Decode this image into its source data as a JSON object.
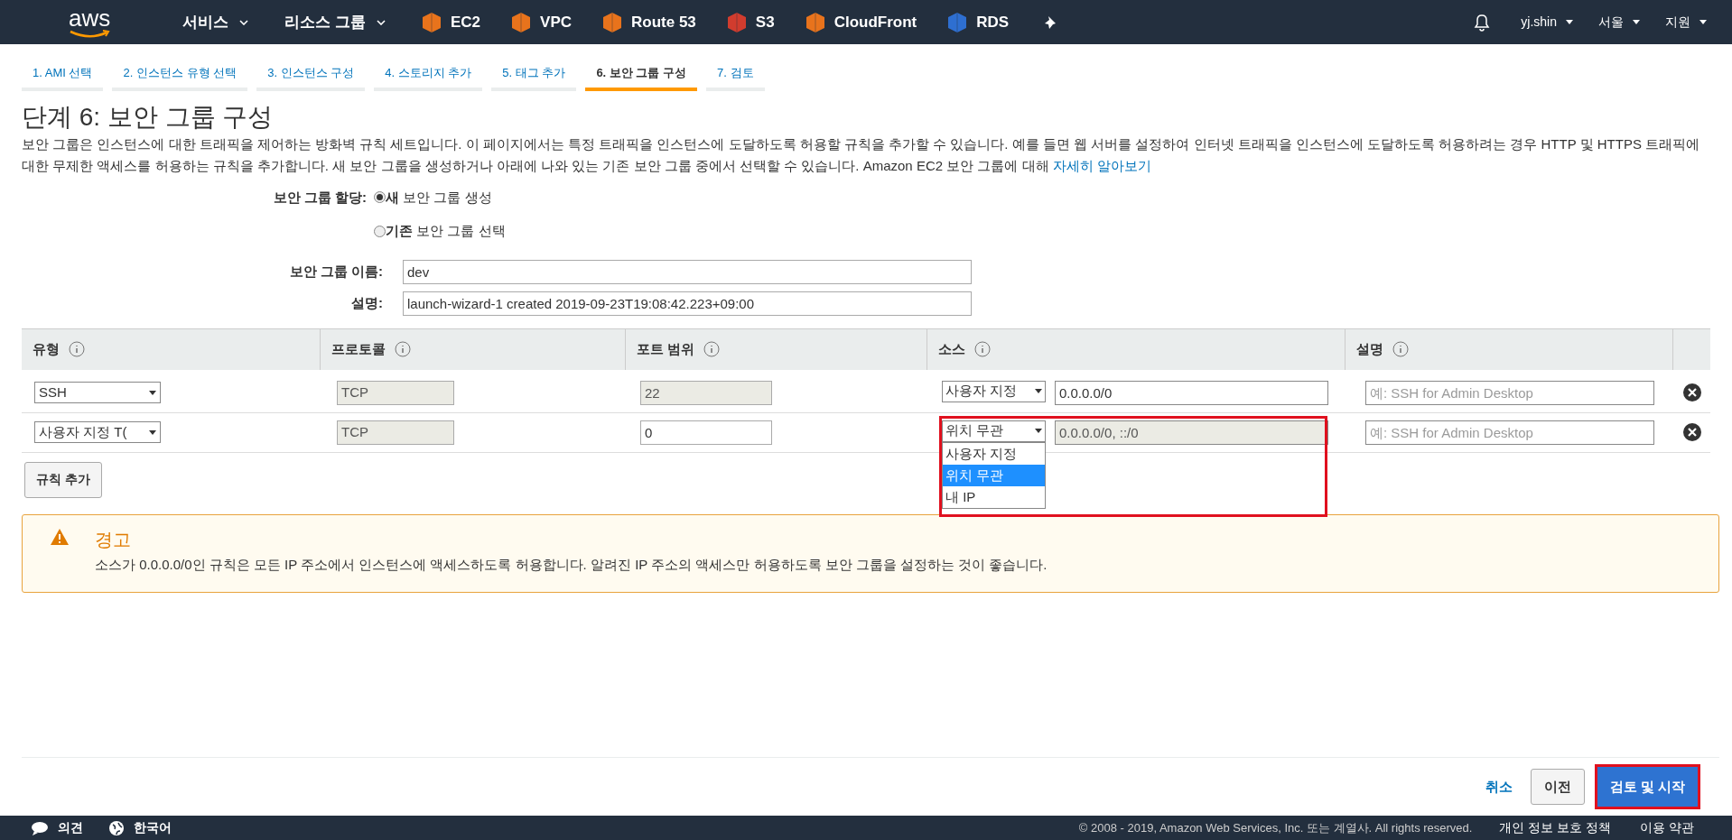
{
  "nav": {
    "logo": "aws",
    "services": "서비스",
    "resource_groups": "리소스 그룹",
    "shortcuts": [
      {
        "label": "EC2",
        "color": "#e8731c"
      },
      {
        "label": "VPC",
        "color": "#e8731c"
      },
      {
        "label": "Route 53",
        "color": "#e8731c"
      },
      {
        "label": "S3",
        "color": "#d13c2e"
      },
      {
        "label": "CloudFront",
        "color": "#e8731c"
      },
      {
        "label": "RDS",
        "color": "#2e6fd1"
      }
    ],
    "user": "yj.shin",
    "region": "서울",
    "support": "지원"
  },
  "wizard_tabs": [
    {
      "label": "1. AMI 선택",
      "selected": false
    },
    {
      "label": "2. 인스턴스 유형 선택",
      "selected": false
    },
    {
      "label": "3. 인스턴스 구성",
      "selected": false
    },
    {
      "label": "4. 스토리지 추가",
      "selected": false
    },
    {
      "label": "5. 태그 추가",
      "selected": false
    },
    {
      "label": "6. 보안 그룹 구성",
      "selected": true
    },
    {
      "label": "7. 검토",
      "selected": false
    }
  ],
  "title": "단계 6: 보안 그룹 구성",
  "description": "보안 그룹은 인스턴스에 대한 트래픽을 제어하는 방화벽 규칙 세트입니다. 이 페이지에서는 특정 트래픽을 인스턴스에 도달하도록 허용할 규칙을 추가할 수 있습니다. 예를 들면 웹 서버를 설정하여 인터넷 트래픽을 인스턴스에 도달하도록 허용하려는 경우 HTTP 및 HTTPS 트래픽에 대한 무제한 액세스를 허용하는 규칙을 추가합니다. 새 보안 그룹을 생성하거나 아래에 나와 있는 기존 보안 그룹 중에서 선택할 수 있습니다. Amazon EC2 보안 그룹에 대해",
  "learn_more": "자세히 알아보기",
  "assign": {
    "label": "보안 그룹 할당:",
    "options": [
      {
        "bold": "새",
        "rest": "보안 그룹 생성",
        "selected": true
      },
      {
        "bold": "기존",
        "rest": "보안 그룹 선택",
        "selected": false
      }
    ]
  },
  "name_field": {
    "label": "보안 그룹 이름:",
    "value": "dev"
  },
  "desc_field": {
    "label": "설명:",
    "value": "launch-wizard-1 created 2019-09-23T19:08:42.223+09:00"
  },
  "table": {
    "columns": [
      "유형",
      "프로토콜",
      "포트 범위",
      "소스",
      "설명"
    ],
    "rows": [
      {
        "type": "SSH",
        "protocol": "TCP",
        "port": "22",
        "port_disabled": true,
        "source": "사용자 지정",
        "cidr": "0.0.0.0/0",
        "cidr_disabled": false,
        "desc_placeholder": "예: SSH for Admin Desktop"
      },
      {
        "type": "사용자 지정 T(",
        "protocol": "TCP",
        "port": "0",
        "port_disabled": false,
        "source": "위치 무관",
        "cidr": "0.0.0.0/0, ::/0",
        "cidr_disabled": true,
        "desc_placeholder": "예: SSH for Admin Desktop",
        "source_menu": [
          {
            "label": "사용자 지정",
            "selected": false
          },
          {
            "label": "위치 무관",
            "selected": true
          },
          {
            "label": "내 IP",
            "selected": false
          }
        ]
      }
    ]
  },
  "add_rule": "규칙 추가",
  "warning": {
    "title": "경고",
    "text": "소스가 0.0.0.0/0인 규칙은 모든 IP 주소에서 인스턴스에 액세스하도록 허용합니다. 알려진 IP 주소의 액세스만 허용하도록 보안 그룹을 설정하는 것이 좋습니다."
  },
  "actions": {
    "cancel": "취소",
    "previous": "이전",
    "launch": "검토 및 시작"
  },
  "footer": {
    "feedback": "의견",
    "language": "한국어",
    "copyright": "© 2008 - 2019, Amazon Web Services, Inc. 또는 계열사. All rights reserved.",
    "privacy": "개인 정보 보호 정책",
    "terms": "이용 약관"
  }
}
